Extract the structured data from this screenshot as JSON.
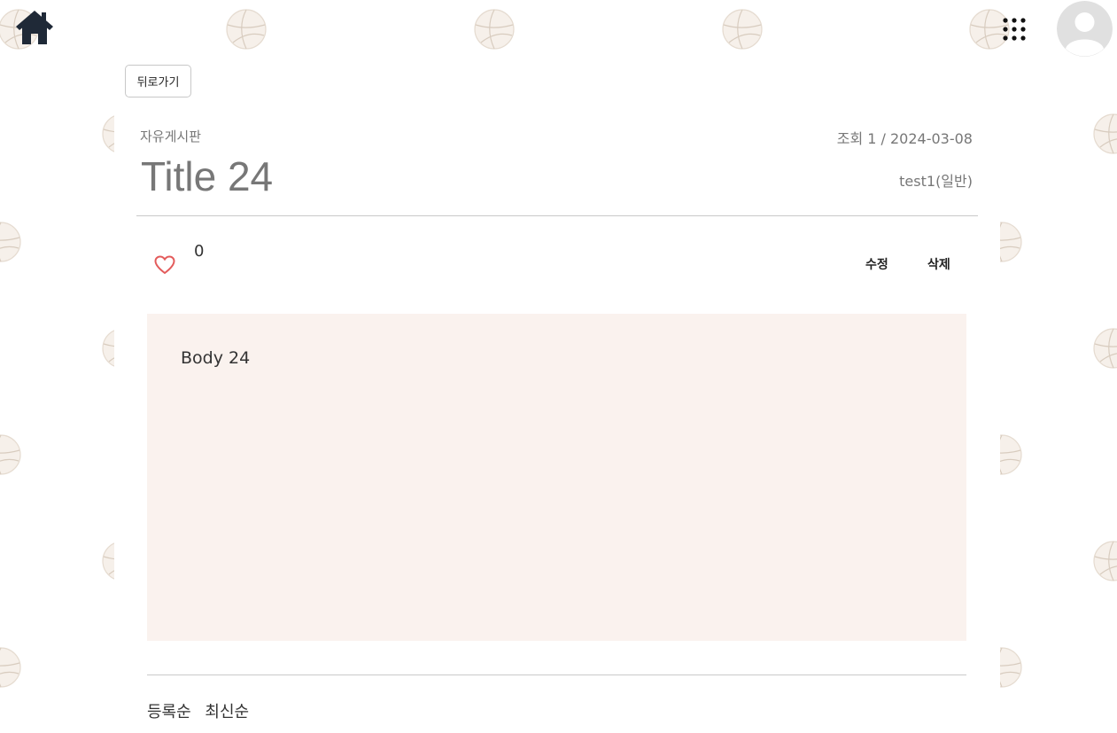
{
  "header": {
    "home_icon": "home-icon",
    "apps_icon": "apps-grid-icon",
    "avatar_icon": "user-avatar-icon"
  },
  "nav": {
    "back_label": "뒤로가기"
  },
  "post": {
    "category": "자유게시판",
    "meta": "조회 1 / 2024-03-08",
    "title": "Title 24",
    "author": "test1(일반)",
    "like_count": "0",
    "like_icon": "heart-icon",
    "edit_label": "수정",
    "delete_label": "삭제",
    "body": "Body 24"
  },
  "comments": {
    "sort_options": [
      "등록순",
      "최신순"
    ]
  },
  "colors": {
    "body_bg": "#faf2ee",
    "heart": "#e35b5b",
    "home_icon": "#1f2937",
    "ball": "#ece4dc"
  }
}
